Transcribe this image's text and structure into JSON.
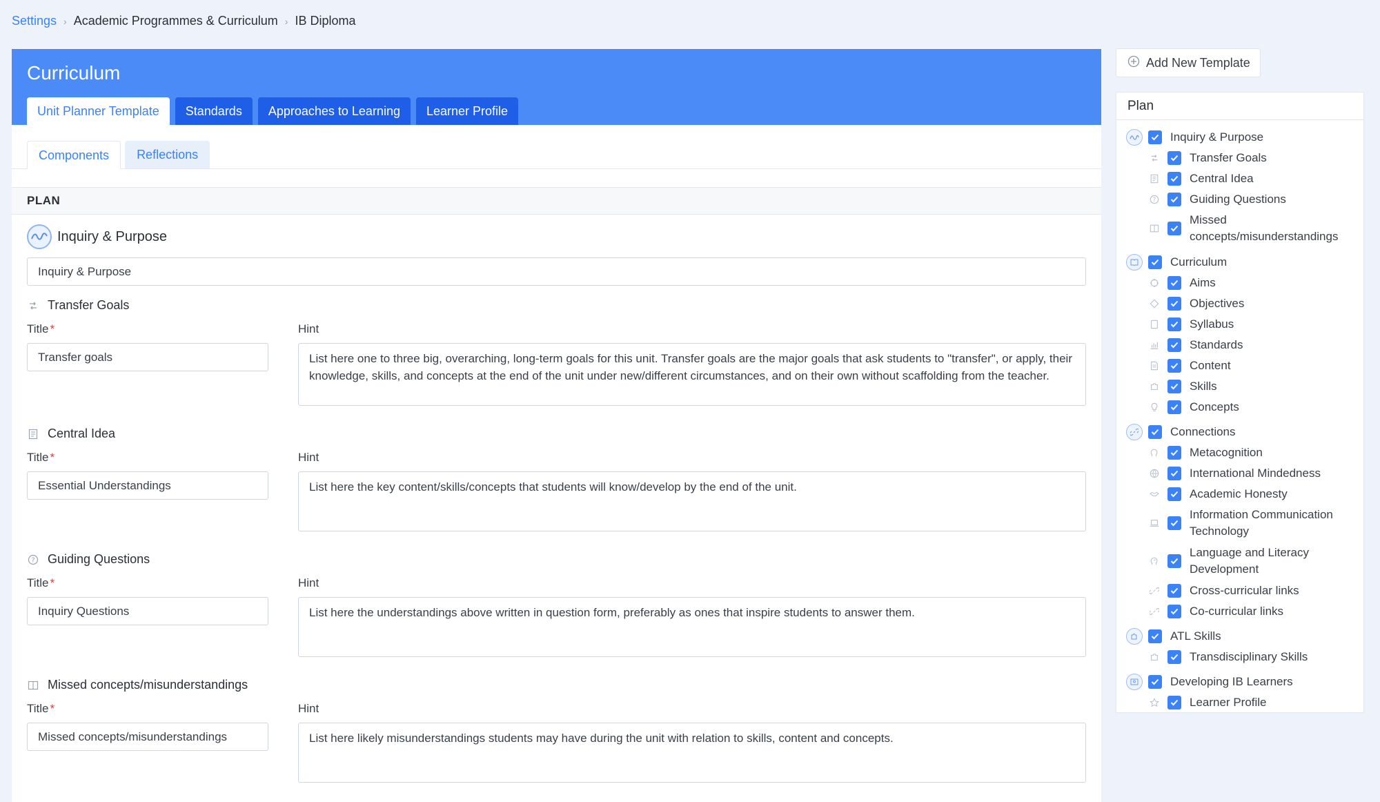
{
  "breadcrumb": {
    "settings": "Settings",
    "programmes": "Academic Programmes & Curriculum",
    "current": "IB Diploma"
  },
  "header": {
    "title": "Curriculum",
    "tabs": [
      "Unit Planner Template",
      "Standards",
      "Approaches to Learning",
      "Learner Profile"
    ]
  },
  "subtabs": [
    "Components",
    "Reflections"
  ],
  "plan": {
    "label": "PLAN",
    "section_title": "Inquiry & Purpose",
    "section_input": "Inquiry & Purpose",
    "title_label": "Title",
    "required_mark": "*",
    "hint_label": "Hint",
    "components": [
      {
        "name": "Transfer Goals",
        "title_value": "Transfer goals",
        "hint": "List here one to three big, overarching, long-term goals for this unit. Transfer goals are the major goals that ask students to \"transfer\", or apply, their knowledge, skills, and concepts at the end of the unit under new/different circumstances, and on their own without scaffolding from the teacher."
      },
      {
        "name": "Central Idea",
        "title_value": "Essential Understandings",
        "hint": "List here the key content/skills/concepts that students will know/develop by the end of the unit."
      },
      {
        "name": "Guiding Questions",
        "title_value": "Inquiry Questions",
        "hint": "List here the understandings above written in question form, preferably as ones that inspire students to answer them."
      },
      {
        "name": "Missed concepts/misunderstandings",
        "title_value": "Missed concepts/misunderstandings",
        "hint": "List here likely misunderstandings students may have during the unit with relation to skills, content and concepts."
      }
    ]
  },
  "sidebar": {
    "add_template": "Add New Template",
    "panel_title": "Plan",
    "groups": [
      {
        "label": "Inquiry & Purpose",
        "items": [
          "Transfer Goals",
          "Central Idea",
          "Guiding Questions",
          "Missed concepts/misunderstandings"
        ]
      },
      {
        "label": "Curriculum",
        "items": [
          "Aims",
          "Objectives",
          "Syllabus",
          "Standards",
          "Content",
          "Skills",
          "Concepts"
        ]
      },
      {
        "label": "Connections",
        "items": [
          "Metacognition",
          "International Mindedness",
          "Academic Honesty",
          "Information Communication Technology",
          "Language and Literacy Development",
          "Cross-curricular links",
          "Co-curricular links"
        ]
      },
      {
        "label": "ATL Skills",
        "items": [
          "Transdisciplinary Skills"
        ]
      },
      {
        "label": "Developing IB Learners",
        "items": [
          "Learner Profile"
        ]
      }
    ]
  }
}
